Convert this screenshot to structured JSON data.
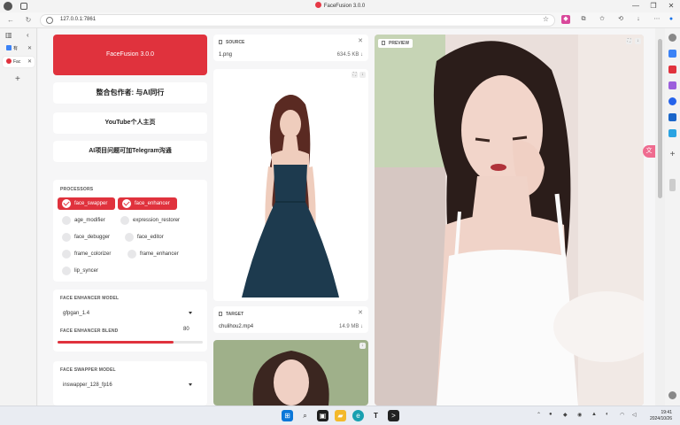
{
  "browser": {
    "window_title": "FaceFusion 3.0.0",
    "url": "127.0.0.1:7861",
    "tabs": [
      {
        "label": "有",
        "active": false
      },
      {
        "label": "Fac",
        "active": true
      }
    ]
  },
  "app": {
    "hero_title": "FaceFusion 3.0.0",
    "links": [
      "整合包作者: 与AI同行",
      "YouTube个人主页",
      "AI项目问题可加Telegram沟通"
    ],
    "processors": {
      "label": "PROCESSORS",
      "items": [
        {
          "name": "face_swapper",
          "checked": true
        },
        {
          "name": "face_enhancer",
          "checked": true
        },
        {
          "name": "age_modifier",
          "checked": false
        },
        {
          "name": "expression_restorer",
          "checked": false
        },
        {
          "name": "face_debugger",
          "checked": false
        },
        {
          "name": "face_editor",
          "checked": false
        },
        {
          "name": "frame_colorizer",
          "checked": false
        },
        {
          "name": "frame_enhancer",
          "checked": false
        },
        {
          "name": "lip_syncer",
          "checked": false
        }
      ]
    },
    "face_enhancer_model": {
      "label": "FACE ENHANCER MODEL",
      "value": "gfpgan_1.4"
    },
    "face_enhancer_blend": {
      "label": "FACE ENHANCER BLEND",
      "value": "80",
      "fraction": 0.8
    },
    "face_swapper_model": {
      "label": "FACE SWAPPER MODEL",
      "value": "inswapper_128_fp16"
    },
    "source": {
      "label": "SOURCE",
      "file": "1.png",
      "size": "634.5 KB ↓"
    },
    "target": {
      "label": "TARGET",
      "file": "chulihou2.mp4",
      "size": "14.9 MB ↓"
    },
    "preview": {
      "label": "PREVIEW"
    }
  },
  "taskbar": {
    "time": "19:41",
    "date": "2024/10/26"
  },
  "colors": {
    "accent": "#e0323d",
    "page_bg": "#f6f6f7"
  }
}
